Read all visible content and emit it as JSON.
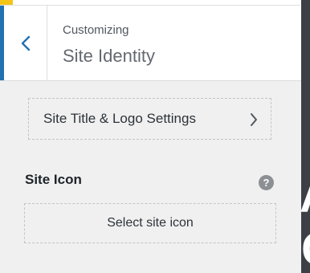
{
  "header": {
    "kicker": "Customizing",
    "title": "Site Identity"
  },
  "nav_item": {
    "label": "Site Title & Logo Settings"
  },
  "site_icon": {
    "label": "Site Icon",
    "help_glyph": "?",
    "select_label": "Select site icon"
  },
  "icons": {
    "back": "chevron-left-icon",
    "forward": "chevron-right-icon",
    "help": "help-icon"
  },
  "colors": {
    "accent": "#2271b1",
    "panel_bg": "#f0f0f1",
    "help_bg": "#8c8f94"
  }
}
